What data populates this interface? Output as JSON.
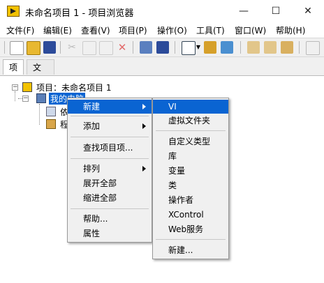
{
  "window": {
    "title": "未命名项目 1 - 项目浏览器",
    "minimize": "—",
    "maximize": "☐",
    "close": "✕"
  },
  "menubar": {
    "items": [
      "文件(F)",
      "编辑(E)",
      "查看(V)",
      "项目(P)",
      "操作(O)",
      "工具(T)",
      "窗口(W)",
      "帮助(H)"
    ]
  },
  "toolbar": {
    "icons": [
      "new-vi-icon",
      "open-icon",
      "save-all-icon",
      "cut-icon",
      "copy-icon",
      "paste-icon",
      "delete-icon",
      "build-icon",
      "save-icon",
      "view-icon",
      "dropdown-icon",
      "filter-icon",
      "tool-icon",
      "collapse-icon",
      "expand-icon",
      "deploy-icon",
      "next-icon"
    ]
  },
  "tabs": {
    "items": [
      "项",
      "文件"
    ]
  },
  "tree": {
    "project": "项目：未命名项目 1",
    "my_computer": "我的电脑",
    "child1_partial": "依",
    "child2_partial": "程"
  },
  "context_menu": {
    "new": "新建",
    "add": "添加",
    "find": "查找项目项...",
    "arrange": "排列",
    "expand_all": "展开全部",
    "collapse_all": "缩进全部",
    "help": "帮助...",
    "properties": "属性"
  },
  "submenu": {
    "vi": "VI",
    "virtual_folder": "虚拟文件夹",
    "typedef": "自定义类型",
    "library": "库",
    "variable": "变量",
    "class": "类",
    "actor": "操作者",
    "xcontrol": "XControl",
    "web_service": "Web服务",
    "new": "新建..."
  },
  "colors": {
    "highlight": "#0a64d2",
    "menu_bg": "#f0f0f0"
  }
}
